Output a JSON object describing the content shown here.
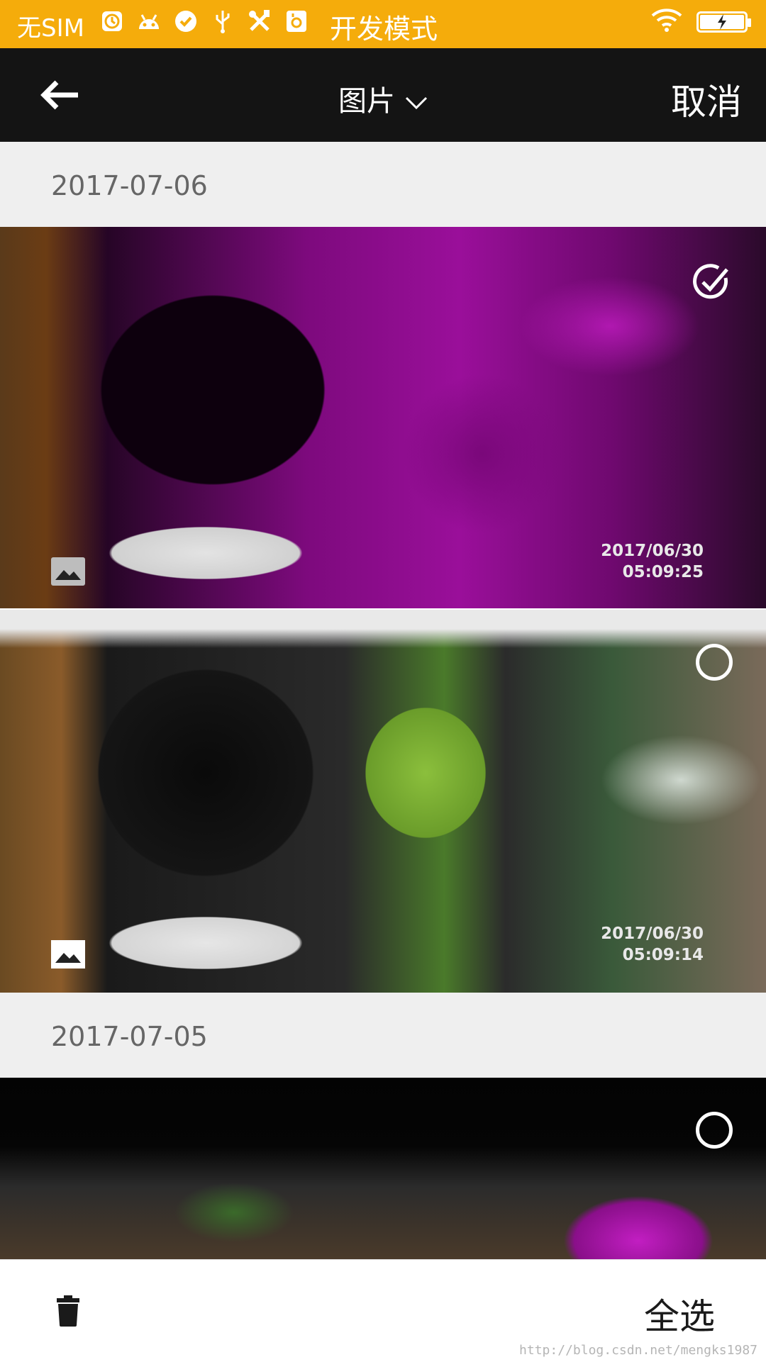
{
  "status_bar": {
    "carrier": "无SIM",
    "mode_label": "开发模式",
    "icons": [
      "clock-icon",
      "android-icon",
      "check-circle-icon",
      "usb-icon",
      "tools-icon",
      "app-icon",
      "wifi-icon",
      "battery-charging-icon"
    ]
  },
  "title_bar": {
    "title": "图片",
    "cancel_label": "取消"
  },
  "sections": [
    {
      "date": "2017-07-06"
    },
    {
      "date": "2017-07-05"
    }
  ],
  "photos": [
    {
      "timestamp_date": "2017/06/30",
      "timestamp_time": "05:09:25",
      "selected": true
    },
    {
      "timestamp_date": "2017/06/30",
      "timestamp_time": "05:09:14",
      "selected": false
    },
    {
      "selected": false
    }
  ],
  "bottom_bar": {
    "select_all_label": "全选"
  },
  "watermark": "http://blog.csdn.net/mengks1987",
  "colors": {
    "status_bar": "#f5ac0b",
    "title_bar": "#141414",
    "date_header_bg": "#efefef"
  }
}
